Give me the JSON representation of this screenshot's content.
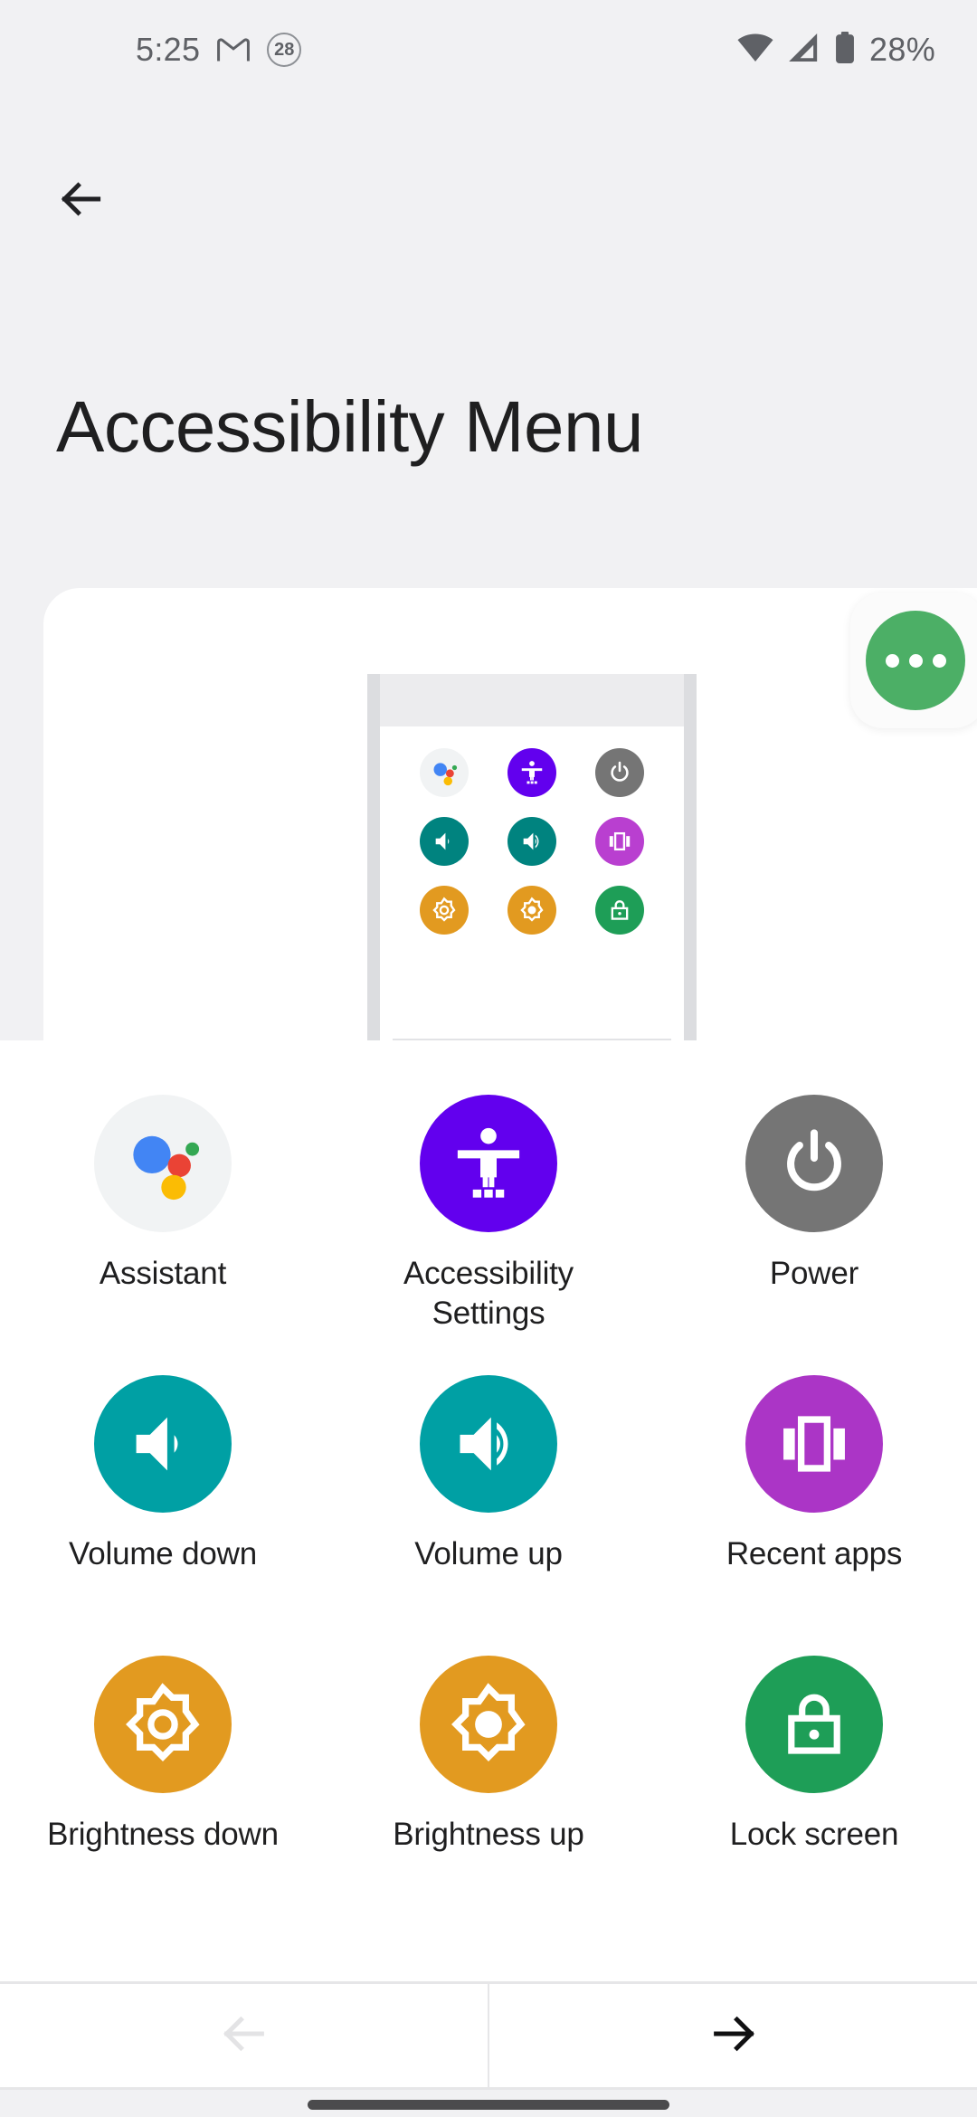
{
  "status_bar": {
    "time": "5:25",
    "gmail_icon": "gmail-icon",
    "notification_badge": "28",
    "wifi_icon": "wifi-icon",
    "cellular_icon": "cellular-signal-icon",
    "battery_icon": "battery-icon",
    "battery_text": "28%"
  },
  "nav": {
    "back_icon": "back-arrow-icon"
  },
  "header": {
    "title": "Accessibility Menu"
  },
  "preview": {
    "fab_icon": "more-options-icon",
    "fab_color": "#4caf66"
  },
  "menu": {
    "items": [
      {
        "label": "Assistant",
        "icon": "assistant-icon",
        "color": "#f1f3f4"
      },
      {
        "label": "Accessibility Settings",
        "icon": "accessibility-settings-icon",
        "color": "#6200ee"
      },
      {
        "label": "Power",
        "icon": "power-icon",
        "color": "#757575"
      },
      {
        "label": "Volume down",
        "icon": "volume-down-icon",
        "color": "#00a0a4"
      },
      {
        "label": "Volume up",
        "icon": "volume-up-icon",
        "color": "#00a0a4"
      },
      {
        "label": "Recent apps",
        "icon": "recent-apps-icon",
        "color": "#ab35c6"
      },
      {
        "label": "Brightness down",
        "icon": "brightness-down-icon",
        "color": "#e29a20"
      },
      {
        "label": "Brightness up",
        "icon": "brightness-up-icon",
        "color": "#e29a20"
      },
      {
        "label": "Lock screen",
        "icon": "lock-screen-icon",
        "color": "#1e9e57"
      }
    ]
  },
  "pager": {
    "previous_icon": "arrow-left-icon",
    "previous_enabled": "false",
    "next_icon": "arrow-right-icon",
    "next_enabled": "true"
  },
  "system": {
    "gesture_bar": "gesture-navigation-bar"
  },
  "colors": {
    "background": "#f1f1f3",
    "sheet": "#ffffff",
    "text_primary": "#1f1f20",
    "text_secondary": "#5f6166"
  }
}
